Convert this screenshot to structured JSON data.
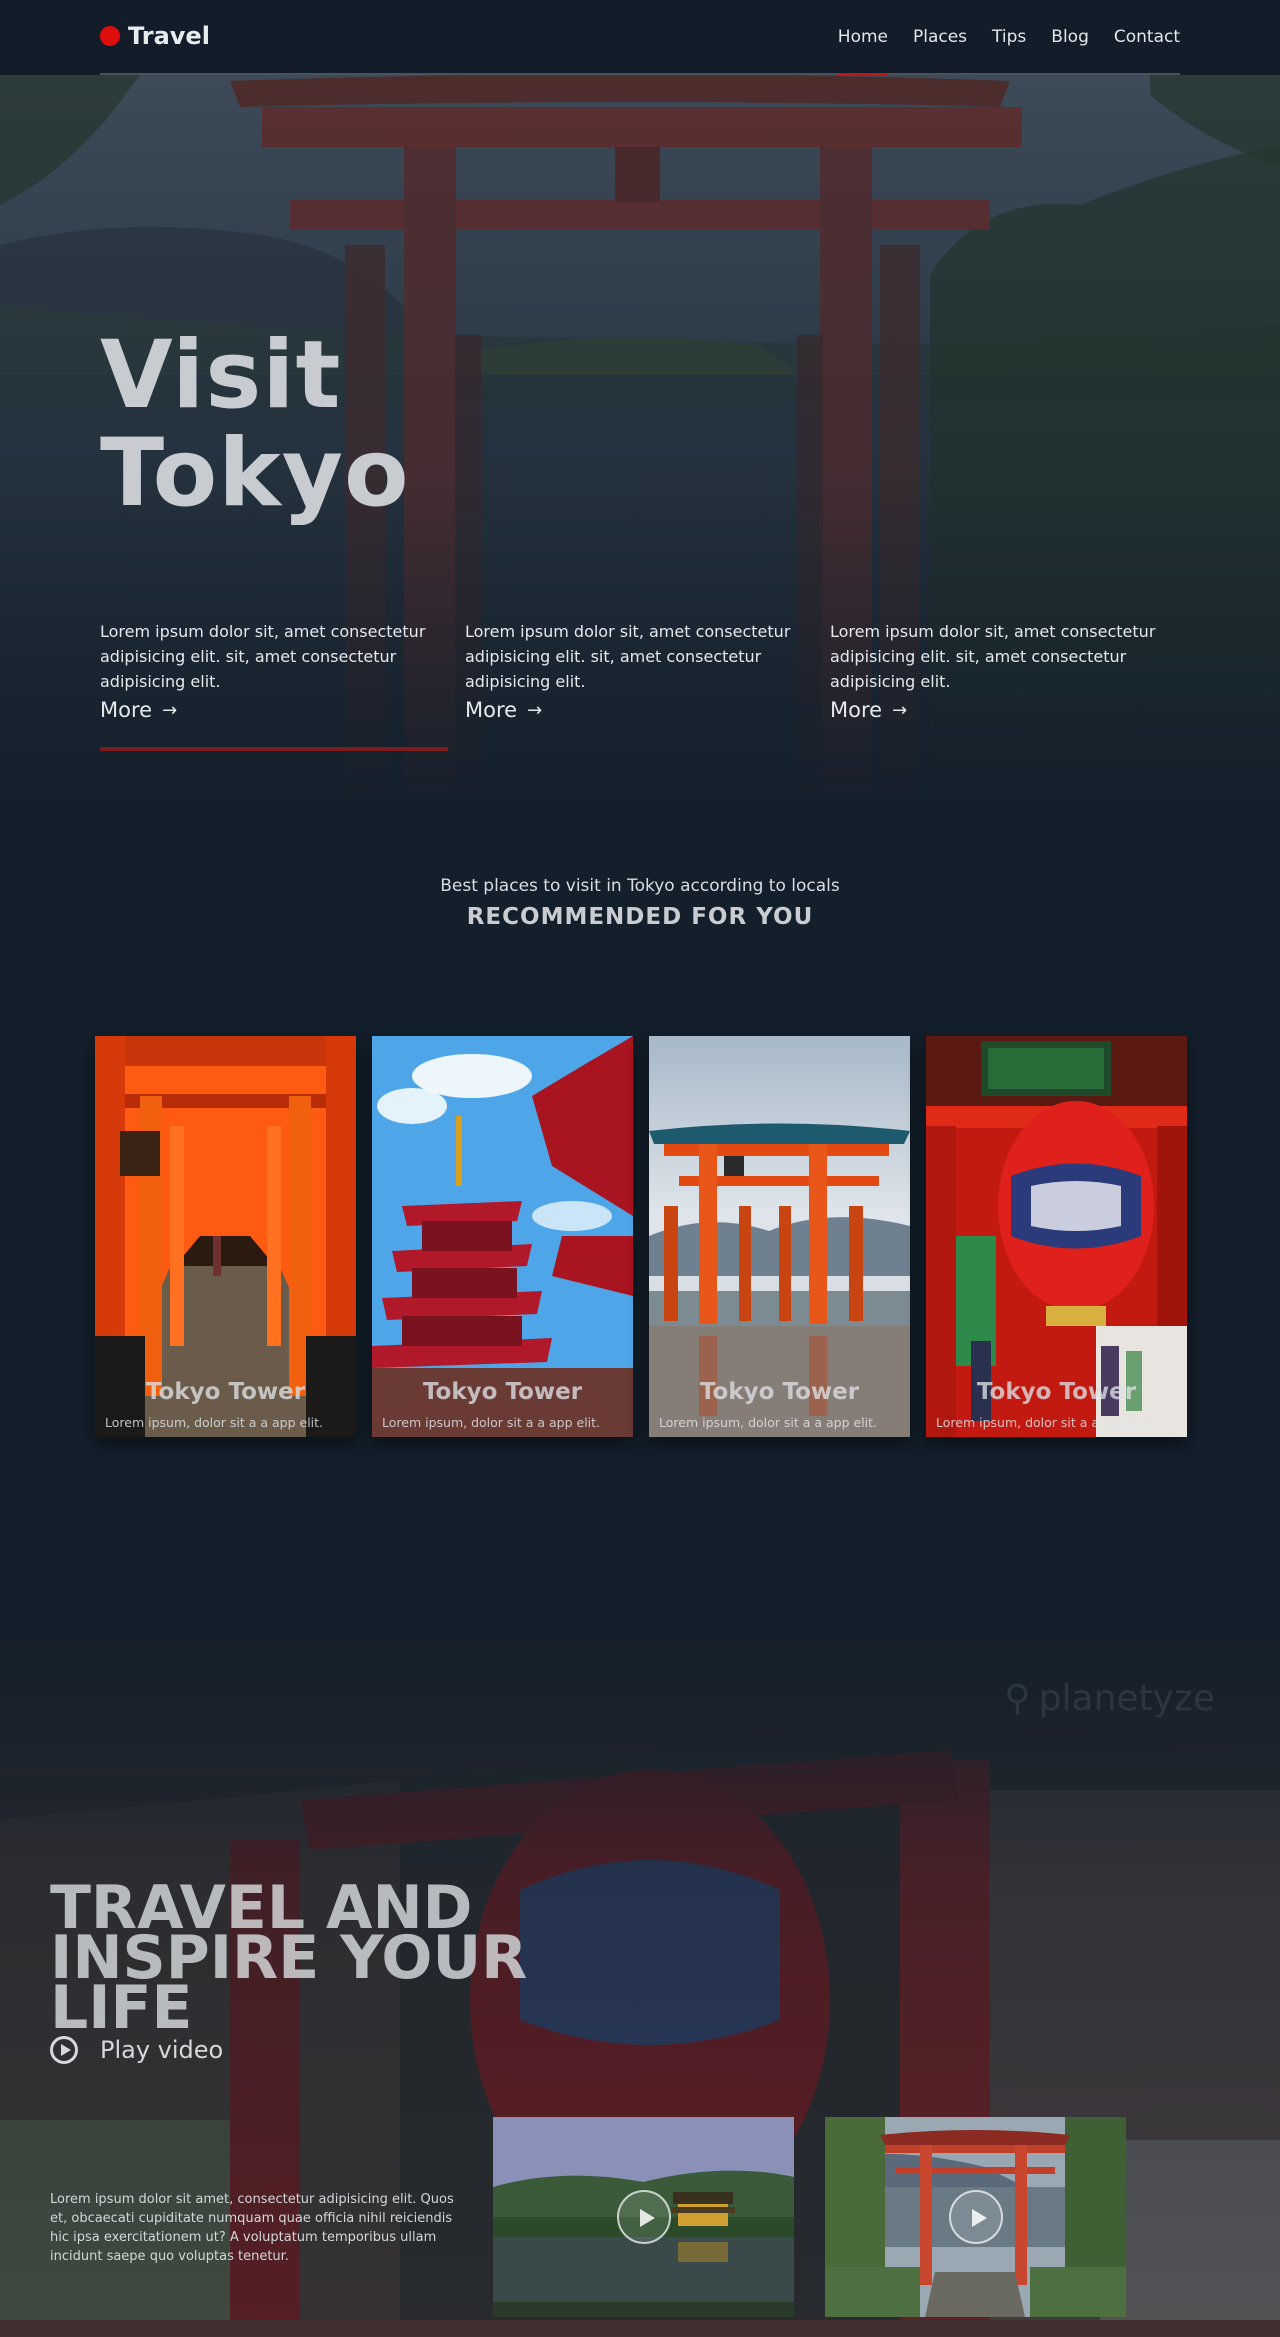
{
  "nav": {
    "brand": "Travel",
    "items": [
      "Home",
      "Places",
      "Tips",
      "Blog",
      "Contact"
    ],
    "active": "Home"
  },
  "hero": {
    "title_line1": "Visit",
    "title_line2": "Tokyo",
    "columns": [
      {
        "text": "Lorem ipsum dolor sit, amet consectetur adipisicing elit. sit, amet consectetur adipisicing elit.",
        "more": "More"
      },
      {
        "text": "Lorem ipsum dolor sit, amet consectetur adipisicing elit. sit, amet consectetur adipisicing elit.",
        "more": "More"
      },
      {
        "text": "Lorem ipsum dolor sit, amet consectetur adipisicing elit. sit, amet consectetur adipisicing elit.",
        "more": "More"
      }
    ]
  },
  "recommended": {
    "subtitle": "Best places to visit in Tokyo according to locals",
    "title": "RECOMMENDED FOR YOU",
    "cards": [
      {
        "title": "Tokyo Tower",
        "desc": "Lorem ipsum, dolor sit a a app elit.",
        "image": "torii-gates-corridor"
      },
      {
        "title": "Tokyo Tower",
        "desc": "Lorem ipsum, dolor sit a a app elit.",
        "image": "pagoda-temple"
      },
      {
        "title": "Tokyo Tower",
        "desc": "Lorem ipsum, dolor sit a a app elit.",
        "image": "floating-torii"
      },
      {
        "title": "Tokyo Tower",
        "desc": "Lorem ipsum, dolor sit a a app elit.",
        "image": "red-lantern-gate"
      }
    ]
  },
  "travel": {
    "watermark": "planetyze",
    "title": "TRAVEL AND INSPIRE YOUR LIFE",
    "play_label": "Play video",
    "text": "Lorem ipsum dolor sit amet, consectetur adipisicing elit. Quos et, obcaecati cupiditate numquam quae officia nihil reiciendis hic ipsa exercitationem ut? A voluptatum temporibus ullam incidunt saepe quo voluptas tenetur.",
    "videos": [
      {
        "image": "golden-pavilion",
        "icon": "play-icon"
      },
      {
        "image": "lakeside-torii",
        "icon": "play-icon"
      }
    ]
  },
  "colors": {
    "background": "#131f2b",
    "accent_red": "#e00d0d",
    "underline_red": "#7f1a1d",
    "text": "#d9dde2"
  }
}
